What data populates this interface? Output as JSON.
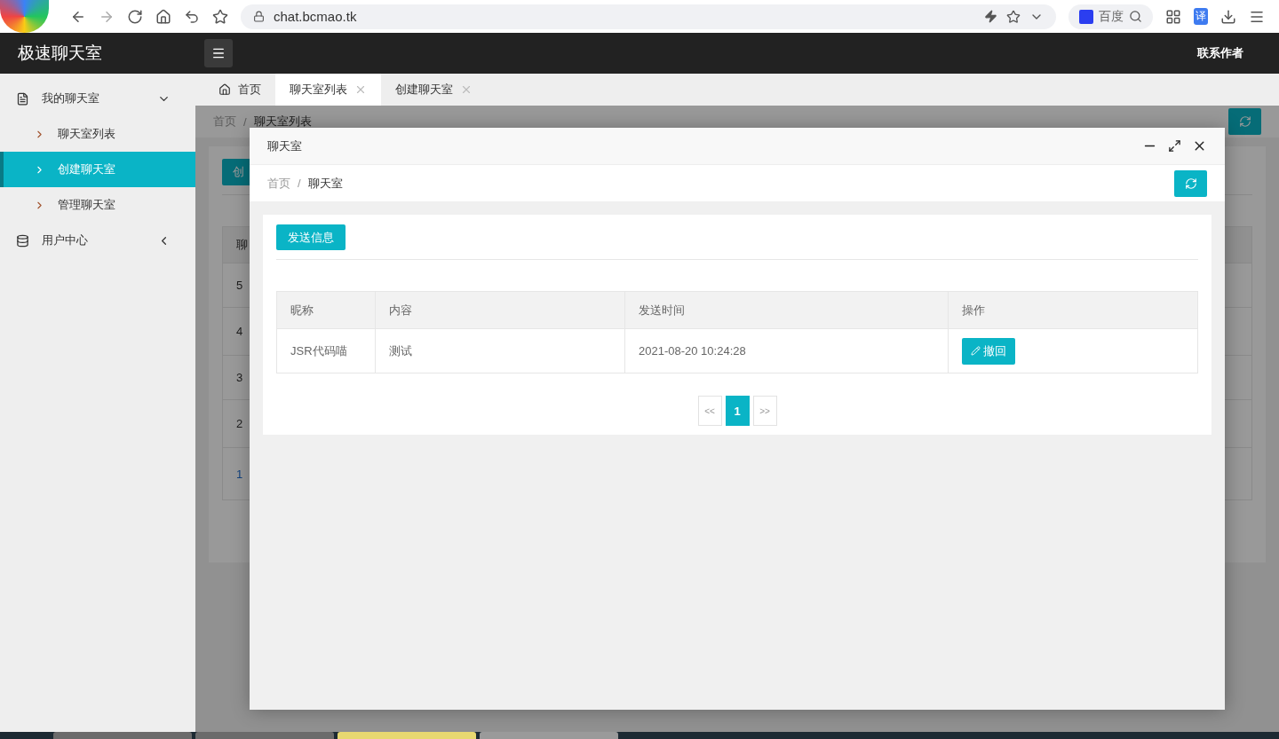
{
  "browser": {
    "url": "chat.bcmao.tk",
    "search_engine": "百度",
    "translate_badge": "译"
  },
  "header": {
    "title": "极速聊天室",
    "author_link": "联系作者"
  },
  "sidebar": {
    "items": [
      {
        "label": "我的聊天室",
        "expanded": true,
        "selected": false,
        "children": [
          {
            "label": "聊天室列表",
            "selected": false
          },
          {
            "label": "创建聊天室",
            "selected": true
          },
          {
            "label": "管理聊天室",
            "selected": false
          }
        ]
      },
      {
        "label": "用户中心",
        "expanded": false,
        "selected": false
      }
    ]
  },
  "tabs": [
    {
      "label": "首页",
      "selected": false,
      "closable": false
    },
    {
      "label": "聊天室列表",
      "selected": true,
      "closable": true
    },
    {
      "label": "创建聊天室",
      "selected": false,
      "closable": true
    }
  ],
  "background_page": {
    "breadcrumb": [
      "首页",
      "聊天室列表"
    ],
    "separator": "/",
    "button": "创",
    "table_header": "聊",
    "rows": [
      "5",
      "4",
      "3",
      "2",
      "1"
    ]
  },
  "modal": {
    "title": "聊天室",
    "breadcrumb": [
      "首页",
      "聊天室"
    ],
    "separator": "/",
    "send_button": "发送信息",
    "columns": [
      "昵称",
      "内容",
      "发送时间",
      "操作"
    ],
    "rows": [
      {
        "nickname": "JSR代码喵",
        "content": "测试",
        "time": "2021-08-20 10:24:28",
        "action": "撤回"
      }
    ],
    "pagination": {
      "prev": "<<",
      "pages": [
        {
          "label": "1",
          "selected": true
        }
      ],
      "next": ">>"
    }
  }
}
